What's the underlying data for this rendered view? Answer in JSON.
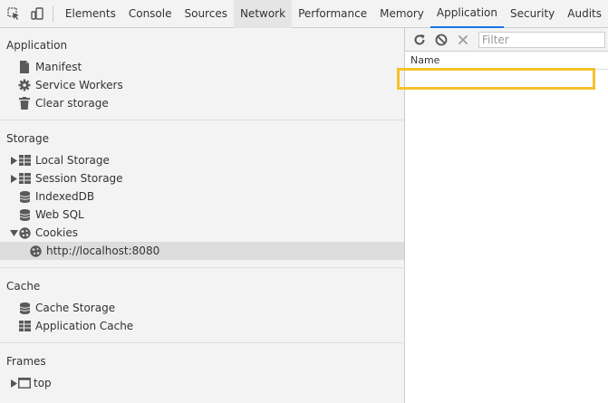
{
  "toolbar": {
    "tabs": [
      "Elements",
      "Console",
      "Sources",
      "Network",
      "Performance",
      "Memory",
      "Application",
      "Security",
      "Audits"
    ],
    "active_tab": "Application",
    "hover_tab": "Network",
    "icons": [
      "inspect-element-icon",
      "device-toggle-icon"
    ]
  },
  "sidebar": {
    "application": {
      "title": "Application",
      "items": [
        {
          "label": "Manifest",
          "icon": "document-icon"
        },
        {
          "label": "Service Workers",
          "icon": "gear-icon"
        },
        {
          "label": "Clear storage",
          "icon": "trash-icon"
        }
      ]
    },
    "storage": {
      "title": "Storage",
      "items": [
        {
          "label": "Local Storage",
          "icon": "grid-icon",
          "expander": "collapsed"
        },
        {
          "label": "Session Storage",
          "icon": "grid-icon",
          "expander": "collapsed"
        },
        {
          "label": "IndexedDB",
          "icon": "database-icon"
        },
        {
          "label": "Web SQL",
          "icon": "database-icon"
        },
        {
          "label": "Cookies",
          "icon": "cookie-icon",
          "expander": "expanded"
        },
        {
          "label": "http://localhost:8080",
          "icon": "cookie-icon",
          "selected": true
        }
      ]
    },
    "cache": {
      "title": "Cache",
      "items": [
        {
          "label": "Cache Storage",
          "icon": "database-icon"
        },
        {
          "label": "Application Cache",
          "icon": "grid-icon"
        }
      ]
    },
    "frames": {
      "title": "Frames",
      "items": [
        {
          "label": "top",
          "icon": "frame-icon",
          "expander": "collapsed"
        }
      ]
    }
  },
  "right_pane": {
    "filter_placeholder": "Filter",
    "column_header": "Name",
    "buttons": [
      "refresh-icon",
      "clear-icon",
      "delete-icon"
    ]
  },
  "colors": {
    "panel_bg": "#f3f3f3",
    "selected_bg": "#dddddd",
    "active_tab_underline": "#1a73e8",
    "highlight": "#f6c12c"
  }
}
